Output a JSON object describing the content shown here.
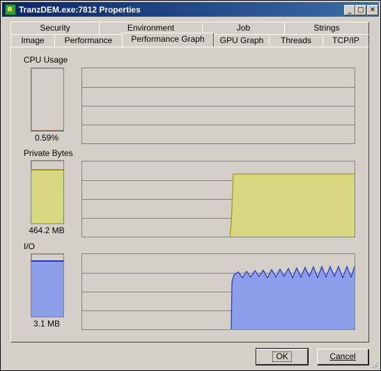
{
  "window": {
    "title": "TranzDEM.exe:7812 Properties",
    "controls": {
      "minimize": "_",
      "maximize": "□",
      "close": "✕"
    }
  },
  "tabs_back": [
    "Security",
    "Environment",
    "Job",
    "Strings"
  ],
  "tabs_front": [
    "Image",
    "Performance",
    "Performance Graph",
    "GPU Graph",
    "Threads",
    "TCP/IP"
  ],
  "active_tab": "Performance Graph",
  "sections": {
    "cpu": {
      "label": "CPU Usage",
      "value": "0.59%",
      "level": 0.0059,
      "color": "#00b000"
    },
    "private": {
      "label": "Private Bytes",
      "value": "464.2 MB",
      "level": 0.85,
      "fill": "#d8d880",
      "line": "#9a9a00"
    },
    "io": {
      "label": "I/O",
      "value": "3.1  MB",
      "level": 0.88,
      "fill": "#8c9ee8",
      "line": "#1c34c8"
    }
  },
  "buttons": {
    "ok": "OK",
    "cancel": "Cancel"
  },
  "colors": {
    "face": "#d4d0c8",
    "grid": "#808080"
  }
}
